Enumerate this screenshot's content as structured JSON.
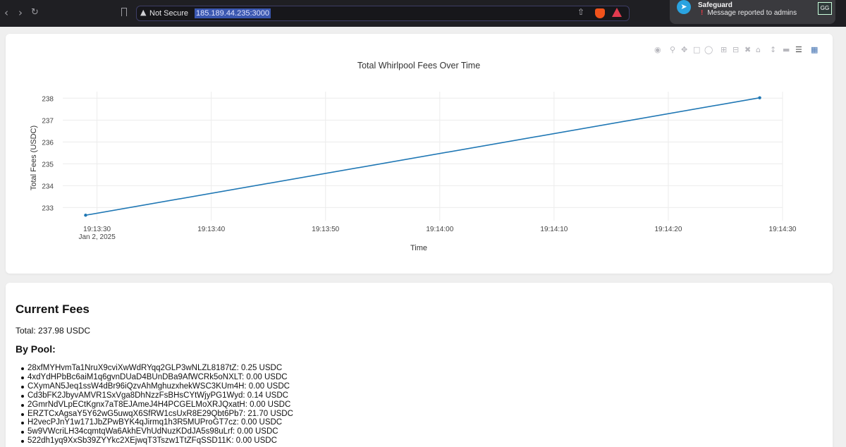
{
  "browser": {
    "security_label": "Not Secure",
    "url": "185.189.44.235:3000"
  },
  "notification": {
    "title": "Safeguard",
    "message": "Message reported to admins",
    "badge": "GG"
  },
  "chart_data": {
    "type": "line",
    "title": "Total Whirlpool Fees Over Time",
    "xlabel": "Time",
    "ylabel": "Total Fees (USDC)",
    "x": [
      "19:13:29",
      "19:14:28"
    ],
    "y": [
      232.65,
      238.02
    ],
    "xlim": [
      "19:13:27",
      "19:14:30"
    ],
    "ylim": [
      232.4,
      238.3
    ],
    "x_ticks": [
      {
        "label": "19:13:30",
        "sub": "Jan 2, 2025"
      },
      {
        "label": "19:13:40",
        "sub": ""
      },
      {
        "label": "19:13:50",
        "sub": ""
      },
      {
        "label": "19:14:00",
        "sub": ""
      },
      {
        "label": "19:14:10",
        "sub": ""
      },
      {
        "label": "19:14:20",
        "sub": ""
      },
      {
        "label": "19:14:30",
        "sub": ""
      }
    ],
    "y_ticks": [
      "233",
      "234",
      "235",
      "236",
      "237",
      "238"
    ],
    "grid": true,
    "line_color": "#1f77b4"
  },
  "fees": {
    "title": "Current Fees",
    "total": "Total: 237.98 USDC",
    "by_pool_label": "By Pool:",
    "pools": [
      "28xfMYHvmTa1NruX9cviXwWdRYqq2GLP3wNLZL8187tZ: 0.25 USDC",
      "4xdYdHPbBc6aiM1q6gvnDUaD4BUnDBa9AfWCRk5oNXLT: 0.00 USDC",
      "CXymAN5Jeq1ssW4dBr96iQzvAhMghuzxhekWSC3KUm4H: 0.00 USDC",
      "Cd3bFK2JbyvAMVR1SxVga8DhNzzFsBHsCYtWjyPG1Wyd: 0.14 USDC",
      "2GmrNdVLpECtKgnx7aT8EJAmeJ4H4PCGELMoXRJQxatH: 0.00 USDC",
      "ERZTCxAgsaY5Y62wG5uwqX6SfRW1csUxR8E29Qbt6Pb7: 21.70 USDC",
      "H2vecPJnY1w171JbZPwBYK4qJirmq1h3R5MUProGT7cz: 0.00 USDC",
      "5w9VWcriLH34cqmtqWa6AkhEVhUdNuzKDdJA5s98uLrf: 0.00 USDC",
      "522dh1yq9XxSb39ZYYkc2XEjwqT3Tszw1TtZFqSSD11K: 0.00 USDC"
    ]
  }
}
